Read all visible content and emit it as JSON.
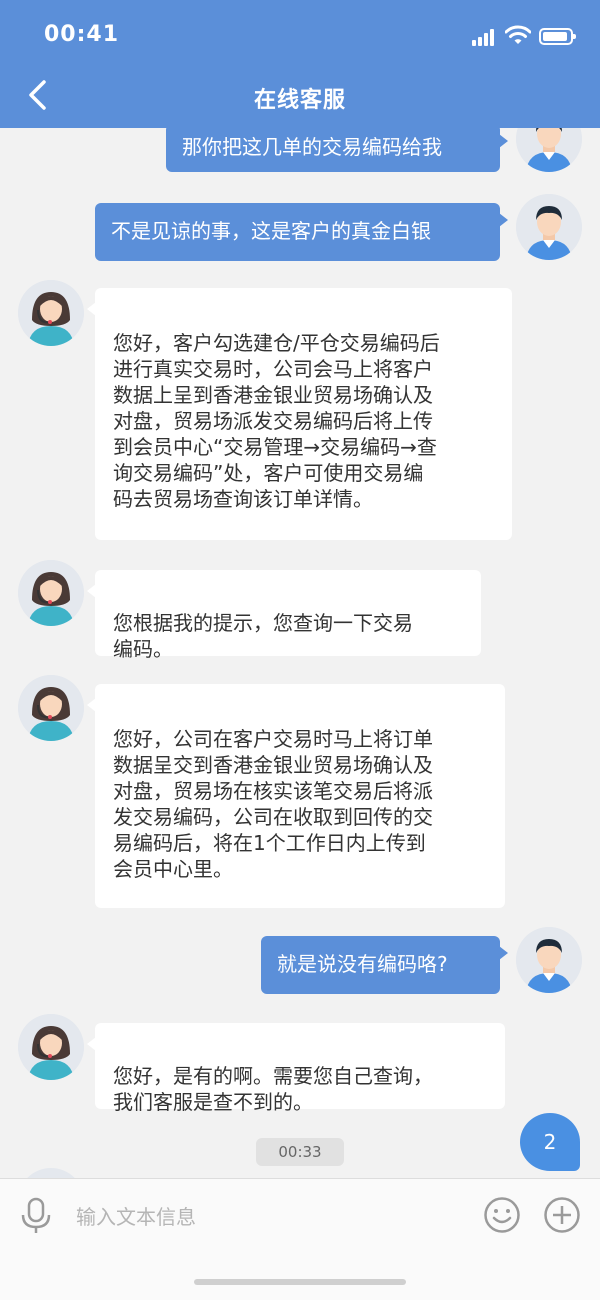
{
  "status_bar": {
    "time": "00:41"
  },
  "header": {
    "title": "在线客服"
  },
  "messages": [
    {
      "role": "user",
      "text": "那你把这几单的交易编码给我"
    },
    {
      "role": "user",
      "text": "不是见谅的事，这是客户的真金白银"
    },
    {
      "role": "agent",
      "text": "您好，客户勾选建仓/平仓交易编码后\n进行真实交易时，公司会马上将客户\n数据上呈到香港金银业贸易场确认及\n对盘，贸易场派发交易编码后将上传\n到会员中心“交易管理→交易编码→查\n询交易编码”处，客户可使用交易编\n码去贸易场查询该订单详情。"
    },
    {
      "role": "agent",
      "text": "您根据我的提示，您查询一下交易\n编码。"
    },
    {
      "role": "agent",
      "text": "您好，公司在客户交易时马上将订单\n数据呈交到香港金银业贸易场确认及\n对盘，贸易场在核实该笔交易后将派\n发交易编码，公司在收取到回传的交\n易编码后，将在1个工作日内上传到\n会员中心里。"
    },
    {
      "role": "user",
      "text": "就是说没有编码咯?"
    },
    {
      "role": "agent",
      "text": "您好，是有的啊。需要您自己查询，\n我们客服是查不到的。"
    }
  ],
  "timestamp": "00:33",
  "unread_badge": "2",
  "input": {
    "placeholder": "输入文本信息",
    "value": ""
  },
  "colors": {
    "accent": "#5b8fd9",
    "background": "#f2f2f2"
  }
}
